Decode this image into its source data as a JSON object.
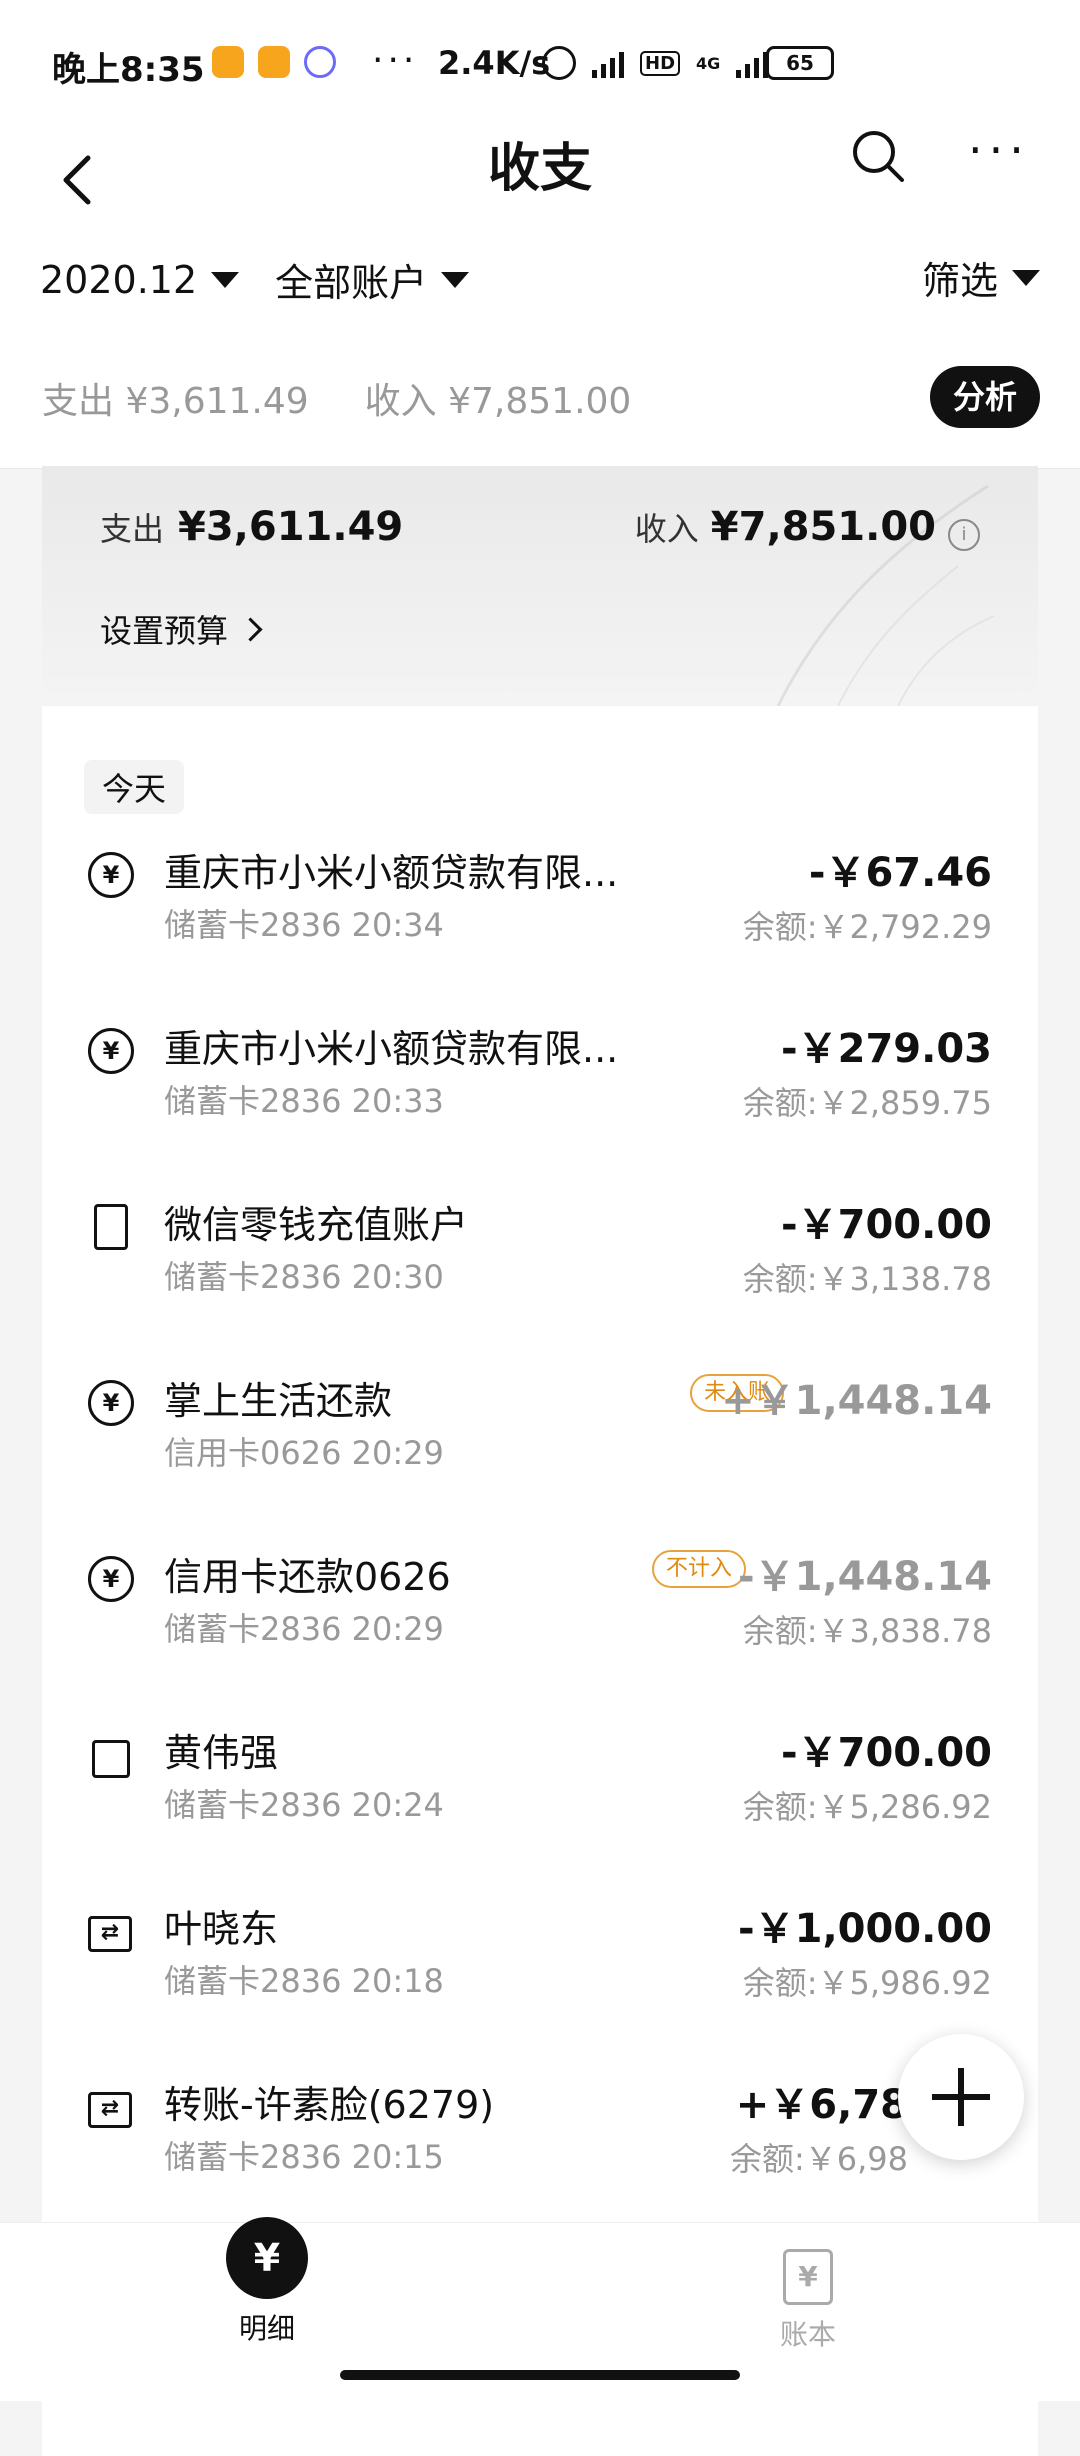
{
  "statusbar": {
    "time": "晚上8:35",
    "speed": "2.4K/s",
    "network": "4G",
    "hd": "HD",
    "battery": "65"
  },
  "header": {
    "title": "收支",
    "period": "2020.12",
    "account": "全部账户",
    "filter": "筛选",
    "summary_expense": "支出 ¥3,611.49",
    "summary_income": "收入 ¥7,851.00",
    "analysis": "分析"
  },
  "banner": {
    "expense_label": "支出",
    "expense_amount": "¥3,611.49",
    "income_label": "收入",
    "income_amount": "¥7,851.00",
    "budget": "设置预算"
  },
  "day_tag": "今天",
  "transactions": [
    {
      "icon": "repayment-icon",
      "name": "重庆市小米小额贷款有限...",
      "sub": "储蓄卡2836 20:34",
      "amount": "-￥67.46",
      "balance": "余额:￥2,792.29"
    },
    {
      "icon": "repayment-icon",
      "name": "重庆市小米小额贷款有限...",
      "sub": "储蓄卡2836 20:33",
      "amount": "-￥279.03",
      "balance": "余额:￥2,859.75"
    },
    {
      "icon": "phone-icon",
      "name": "微信零钱充值账户",
      "sub": "储蓄卡2836 20:30",
      "amount": "-￥700.00",
      "balance": "余额:￥3,138.78"
    },
    {
      "icon": "repayment-icon",
      "name": "掌上生活还款",
      "sub": "信用卡0626 20:29",
      "amount": "+￥1,448.14",
      "badge": "未入账",
      "balance": ""
    },
    {
      "icon": "repayment-icon",
      "name": "信用卡还款0626",
      "sub": "储蓄卡2836 20:29",
      "amount": "-￥1,448.14",
      "badge": "不计入",
      "balance": "余额:￥3,838.78"
    },
    {
      "icon": "shopping-bag-icon",
      "name": "黄伟强",
      "sub": "储蓄卡2836 20:24",
      "amount": "-￥700.00",
      "balance": "余额:￥5,286.92"
    },
    {
      "icon": "transfer-icon",
      "name": "叶晓东",
      "sub": "储蓄卡2836 20:18",
      "amount": "-￥1,000.00",
      "balance": "余额:￥5,986.92"
    },
    {
      "icon": "transfer-icon",
      "name": "转账-许素脸(6279)",
      "sub": "储蓄卡2836 20:15",
      "amount": "+￥6,78",
      "balance": "余额:￥6,98"
    }
  ],
  "bottom_nav": {
    "details": "明细",
    "ledger": "账本"
  }
}
